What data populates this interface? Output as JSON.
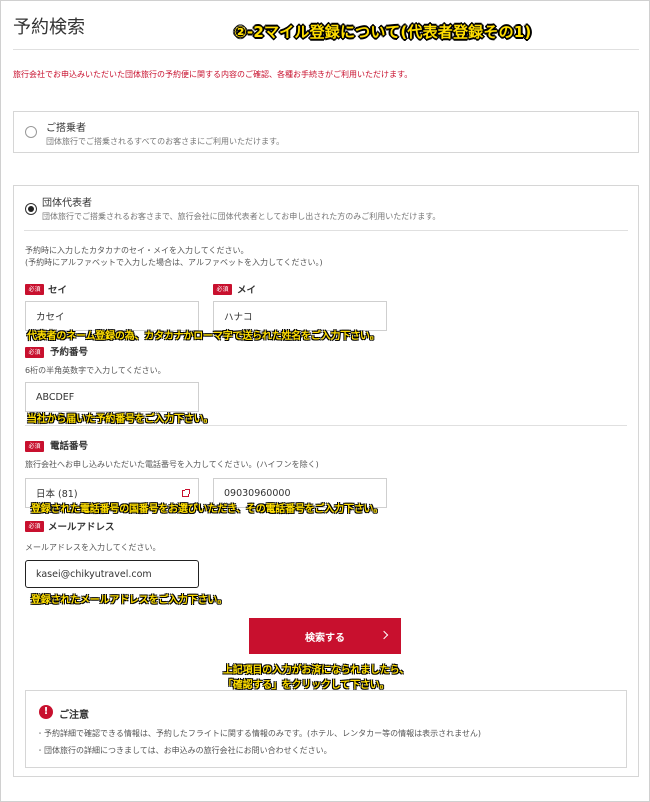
{
  "page": {
    "title": "予約検索",
    "banner": "②-2マイル登録について(代表者登録その1)",
    "intro": "旅行会社でお申込みいただいた団体旅行の予約便に関する内容のご確認、各種お手続きがご利用いただけます。"
  },
  "options": {
    "passenger": {
      "title": "ご搭乗者",
      "desc": "団体旅行でご搭乗されるすべてのお客さまにご利用いただけます。"
    },
    "representative": {
      "title": "団体代表者",
      "desc": "団体旅行でご搭乗されるお客さまで、旅行会社に団体代表者としてお申し出された方のみご利用いただけます。"
    }
  },
  "form": {
    "name_help_1": "予約時に入力したカタカナのセイ・メイを入力してください。",
    "name_help_2": "(予約時にアルファベットで入力した場合は、アルファベットを入力してください。)",
    "required": "必須",
    "sei_label": "セイ",
    "sei_value": "カセイ",
    "mei_label": "メイ",
    "mei_value": "ハナコ",
    "booking_label": "予約番号",
    "booking_help": "6桁の半角英数字で入力してください。",
    "booking_value": "ABCDEF",
    "phone_label": "電話番号",
    "phone_help": "旅行会社へお申し込みいただいた電話番号を入力してください。(ハイフンを除く)",
    "country_value": "日本 (81)",
    "phone_value": "09030960000",
    "email_label": "メールアドレス",
    "email_help": "メールアドレスを入力してください。",
    "email_value": "kasei@chikyutravel.com",
    "search_label": "検索する"
  },
  "notes": {
    "name": "代表者のネーム登録の為、カタカナかローマ字で送られた姓名をご入力下さい。",
    "booking": "当社から届いた予約番号をご入力下さい。",
    "phone": "登録された電話番号の国番号をお選びいただき、その電話番号をご入力下さい。",
    "email": "登録されたメールアドレスをご入力下さい。",
    "search_1": "上記項目の入力がお済になられましたら、",
    "search_2": "「確認する」をクリックして下さい。"
  },
  "caution": {
    "icon": "!",
    "title": "ご注意",
    "item_1": "予約詳細で確認できる情報は、予約したフライトに関する情報のみです。(ホテル、レンタカー等の情報は表示されません)",
    "item_2": "団体旅行の詳細につきましては、お申込みの旅行会社にお問い合わせください。"
  },
  "colors": {
    "accent": "#c8102e",
    "note_yellow": "#ffde00"
  }
}
